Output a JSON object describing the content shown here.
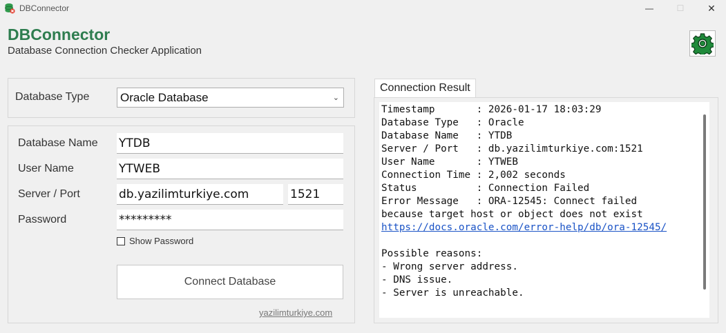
{
  "window": {
    "title": "DBConnector",
    "minimize": "—",
    "maximize": "☐",
    "close": "✕"
  },
  "header": {
    "title": "DBConnector",
    "subtitle": "Database Connection Checker Application"
  },
  "form": {
    "db_type_label": "Database Type",
    "db_type_value": "Oracle Database",
    "db_name_label": "Database Name",
    "db_name_value": "YTDB",
    "user_label": "User Name",
    "user_value": "YTWEB",
    "server_label": "Server / Port",
    "server_value": "db.yazilimturkiye.com",
    "port_value": "1521",
    "password_label": "Password",
    "password_value": "*********",
    "show_password_label": "Show Password",
    "connect_label": "Connect Database",
    "site_link": "yazilimturkiye.com"
  },
  "result": {
    "tab_label": "Connection Result",
    "lines_before_link": "Timestamp       : 2026-01-17 18:03:29\nDatabase Type   : Oracle\nDatabase Name   : YTDB\nServer / Port   : db.yazilimturkiye.com:1521\nUser Name       : YTWEB\nConnection Time : 2,002 seconds\nStatus          : Connection Failed\nError Message   : ORA-12545: Connect failed\nbecause target host or object does not exist\n",
    "link": "https://docs.oracle.com/error-help/db/ora-12545/",
    "lines_after_link": "\n\nPossible reasons:\n- Wrong server address.\n- DNS issue.\n- Server is unreachable."
  },
  "colors": {
    "brand": "#2e7d4f",
    "link": "#1a53c6"
  }
}
